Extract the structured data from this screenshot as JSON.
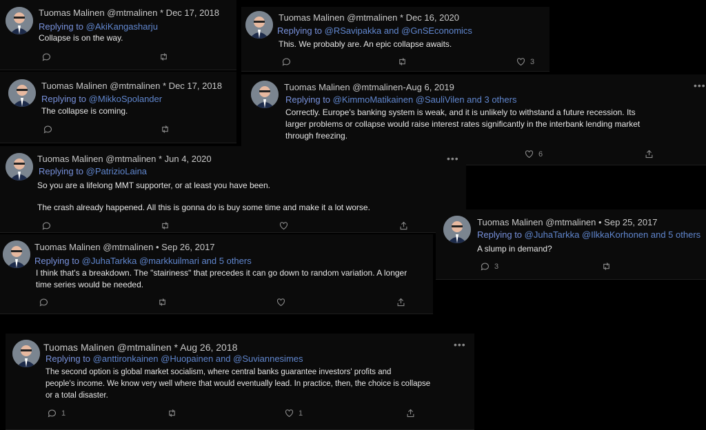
{
  "author": "Tuomas Malinen @mtmalinen",
  "tweets": [
    {
      "date": "* Dec 17, 2018",
      "replying": "Replying to",
      "to": "@AkiKangasharju",
      "text": [
        "Collapse is on the way."
      ],
      "likes": "",
      "replies": ""
    },
    {
      "date": "* Dec 16, 2020",
      "replying": "Replying to",
      "to": "@RSavipakka and @GnSEconomics",
      "text": [
        "This. We probably are. An epic collapse awaits."
      ],
      "likes": "3",
      "replies": ""
    },
    {
      "date": "* Dec 17, 2018",
      "replying": "Replying to",
      "to": "@MikkoSpolander",
      "text": [
        "The collapse is coming."
      ],
      "likes": "",
      "replies": ""
    },
    {
      "date": "-Aug 6, 2019",
      "replying": "Replying to",
      "to": "@KimmoMatikainen @SauliVilen and 3 others",
      "text": [
        "Correctly. Europe's banking system is weak, and it is unlikely to withstand a future recession. Its",
        "larger problems or collapse would raise interest rates significantly in the interbank lending market",
        "through freezing."
      ],
      "likes": "6",
      "replies": ""
    },
    {
      "date": "* Jun 4, 2020",
      "replying": "Replying to",
      "to": "@PatrizioLaina",
      "text": [
        "So you are a lifelong MMT supporter, or at least you have been.",
        "",
        "The crash already happened. All this is gonna do is buy some time and make it a lot worse."
      ],
      "likes": "",
      "replies": ""
    },
    {
      "date": "• Sep 25, 2017",
      "replying": "Replying to",
      "to": "@JuhaTarkka @IlkkaKorhonen and 5 others",
      "text": [
        "A slump in demand?"
      ],
      "likes": "",
      "replies": "3"
    },
    {
      "date": "• Sep 26, 2017",
      "replying": "Replying to",
      "to": "@JuhaTarkka @markkuilmari and 5 others",
      "text": [
        "I think that's a breakdown. The \"stairiness\" that precedes it can go down to random variation. A longer",
        "time series would be needed."
      ],
      "likes": "",
      "replies": ""
    },
    {
      "date": "* Aug 26, 2018",
      "replying": "Replying to",
      "to": "@anttironkainen @Huopainen and @Suviannesimes",
      "text": [
        "The second option is global market socialism, where central banks guarantee investors' profits and",
        "people's income. We know very well where that would eventually lead. In practice, then, the choice is collapse",
        "or a total disaster."
      ],
      "likes": "1",
      "replies": "1"
    }
  ],
  "more_label": "•••"
}
